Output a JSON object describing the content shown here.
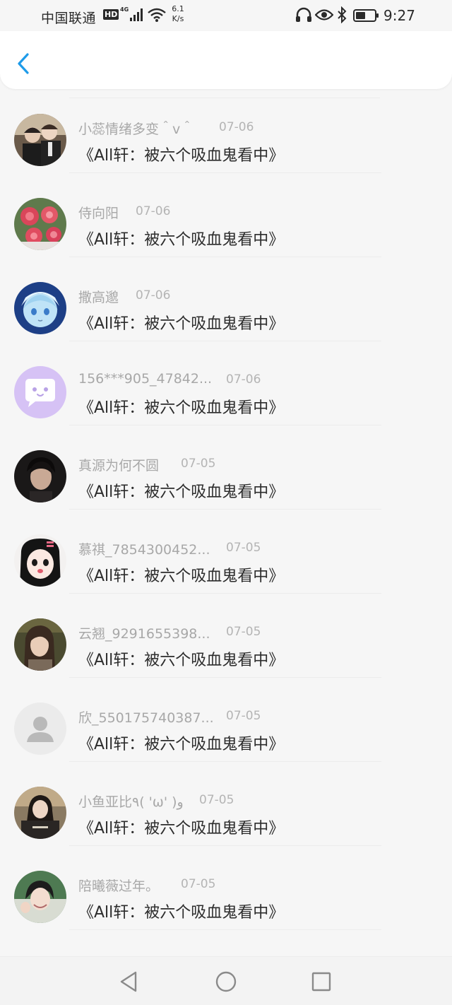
{
  "status_bar": {
    "carrier": "中国联通",
    "hd": "HD",
    "network": "4G",
    "speed_value": "6.1",
    "speed_unit": "K/s",
    "time": "9:27"
  },
  "header": {
    "back_icon": "chevron-left-icon",
    "accent": "#1e9be9"
  },
  "items": [
    {
      "name": "小蕊情绪多变＾v＾",
      "date": "07-06",
      "message": "《All轩：被六个吸血鬼看中》",
      "avatar": "photo-couple"
    },
    {
      "name": "侍向阳",
      "date": "07-06",
      "message": "《All轩：被六个吸血鬼看中》",
      "avatar": "photo-roses"
    },
    {
      "name": "撒高邈",
      "date": "07-06",
      "message": "《All轩：被六个吸血鬼看中》",
      "avatar": "anime-blue"
    },
    {
      "name": "156***905_47842...",
      "date": "07-06",
      "message": "《All轩：被六个吸血鬼看中》",
      "avatar": "default-chat-bubble"
    },
    {
      "name": "真源为何不圆",
      "date": "07-05",
      "message": "《All轩：被六个吸血鬼看中》",
      "avatar": "photo-dark"
    },
    {
      "name": "慕祺_7854300452...",
      "date": "07-05",
      "message": "《All轩：被六个吸血鬼看中》",
      "avatar": "anime-girl"
    },
    {
      "name": "云翘_9291655398...",
      "date": "07-05",
      "message": "《All轩：被六个吸血鬼看中》",
      "avatar": "photo-girl"
    },
    {
      "name": "欣_550175740387...",
      "date": "07-05",
      "message": "《All轩：被六个吸血鬼看中》",
      "avatar": "default-person"
    },
    {
      "name": "小鱼亚比٩( 'ω' )و",
      "date": "07-05",
      "message": "《All轩：被六个吸血鬼看中》",
      "avatar": "photo-sweater"
    },
    {
      "name": "陪曦薇过年。",
      "date": "07-05",
      "message": "《All轩：被六个吸血鬼看中》",
      "avatar": "photo-smile"
    }
  ],
  "nav_bar": {
    "back": "triangle-back-icon",
    "home": "circle-home-icon",
    "recents": "square-recents-icon"
  }
}
